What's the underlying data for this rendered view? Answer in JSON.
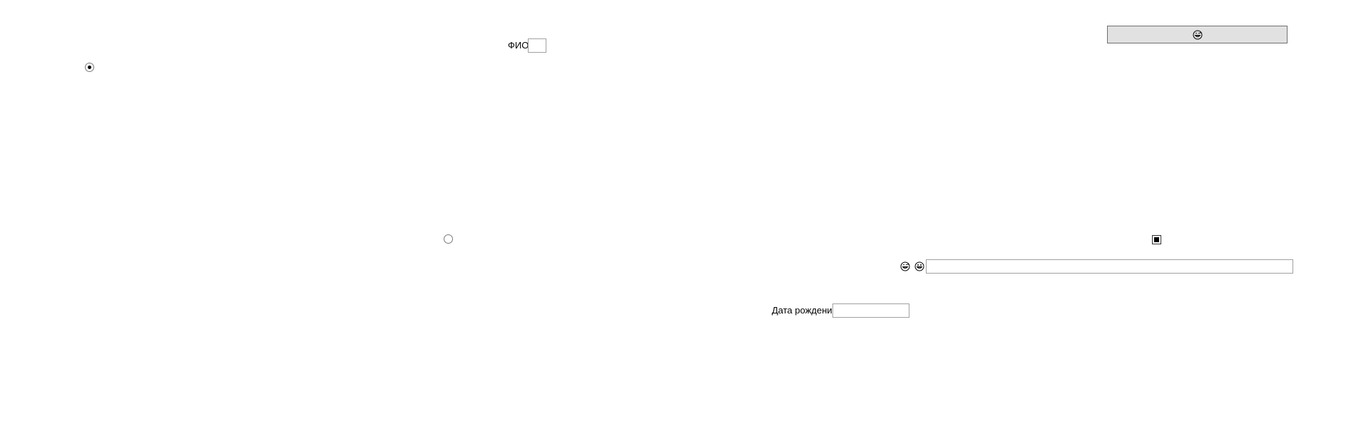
{
  "form": {
    "fio": {
      "label": "ФИО",
      "value": ""
    },
    "birth_date": {
      "label": "Дата рождения",
      "value": ""
    },
    "wide_field": {
      "value": ""
    },
    "radio_1": {
      "checked": true
    },
    "radio_2": {
      "checked": false
    },
    "checkbox": {
      "checked": true
    },
    "button": {
      "icon": "grinning-face-with-sweat-icon"
    },
    "icons": [
      "grinning-face-with-sweat-icon",
      "grinning-face-icon"
    ]
  }
}
